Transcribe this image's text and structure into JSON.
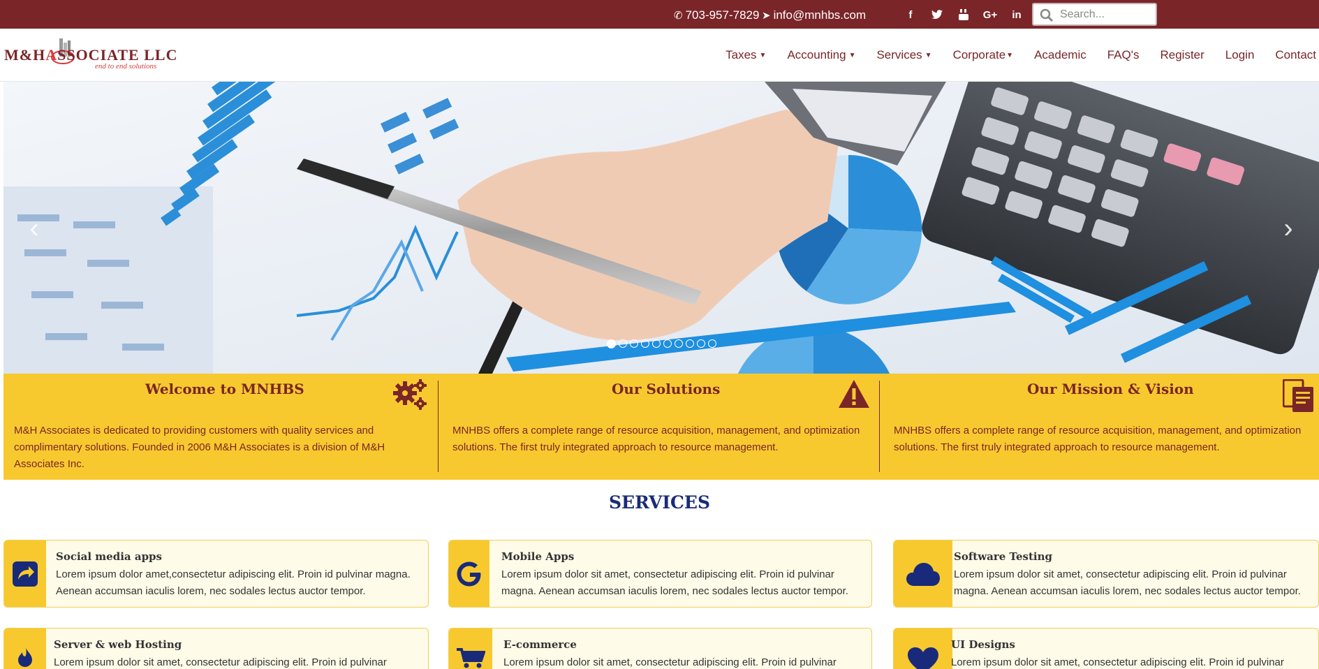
{
  "topbar": {
    "phone": "703-957-7829",
    "email": "info@mnhbs.com",
    "social": [
      "f",
      "t",
      "▶",
      "G+",
      "in"
    ],
    "search_placeholder": "Search..."
  },
  "logo": {
    "main_left": "M&H",
    "main_mid": "A",
    "main_right": "SSOCIATE LLC",
    "tagline": "end to end solutions"
  },
  "nav": {
    "items": [
      {
        "label": "Taxes",
        "dropdown": true
      },
      {
        "label": "Accounting",
        "dropdown": true
      },
      {
        "label": "Services",
        "dropdown": true
      },
      {
        "label": "Corporate",
        "dropdown": true
      },
      {
        "label": "Academic",
        "dropdown": false
      },
      {
        "label": "FAQ's",
        "dropdown": false
      },
      {
        "label": "Register",
        "dropdown": false
      },
      {
        "label": "Login",
        "dropdown": false
      },
      {
        "label": "Contact",
        "dropdown": false
      }
    ]
  },
  "hero": {
    "slide_count": 10,
    "active_slide": 1,
    "prev_label": "‹",
    "next_label": "›"
  },
  "band": {
    "welcome_title": "Welcome to MNHBS",
    "welcome_text": "M&H Associates is dedicated to providing customers with quality services and complimentary solutions. Founded in 2006 M&H Associates is a division of M&H Associates Inc.",
    "solutions_title": "Our Solutions",
    "solutions_text": "MNHBS offers a complete range of resource acquisition, management, and optimization solutions. The first truly integrated approach to resource management.",
    "mission_title": "Our Mission & Vision",
    "mission_text": "MNHBS offers a complete range of resource acquisition, management, and optimization solutions. The first truly integrated approach to resource management."
  },
  "services": {
    "title": "SERVICES",
    "items": [
      {
        "title": "Social media apps",
        "text": "Lorem ipsum dolor amet,consectetur adipiscing elit. Proin id pulvinar magna. Aenean accumsan iaculis lorem, nec sodales lectus auctor tempor.",
        "icon": "share-icon"
      },
      {
        "title": "Mobile Apps",
        "text": "Lorem ipsum dolor sit amet, consectetur adipiscing elit. Proin id pulvinar magna. Aenean accumsan iaculis lorem, nec sodales lectus auctor tempor.",
        "icon": "google-icon"
      },
      {
        "title": "Software Testing",
        "text": "Lorem ipsum dolor sit amet, consectetur adipiscing elit. Proin id pulvinar magna. Aenean accumsan iaculis lorem, nec sodales lectus auctor tempor.",
        "icon": "cloud-icon"
      },
      {
        "title": "Server & web Hosting",
        "text": "Lorem ipsum dolor sit amet, consectetur adipiscing elit. Proin id pulvinar magna.",
        "icon": "flame-icon"
      },
      {
        "title": "E-commerce",
        "text": "Lorem ipsum dolor sit amet, consectetur adipiscing elit. Proin id pulvinar",
        "icon": "cart-icon"
      },
      {
        "title": "UI Designs",
        "text": "Lorem ipsum dolor sit amet, consectetur adipiscing elit. Proin id pulvinar",
        "icon": "heart-icon"
      }
    ]
  },
  "colors": {
    "maroon": "#7a2528",
    "yellow": "#f8c92f",
    "navy": "#1a2a7a",
    "card_bg": "#fefbe8"
  }
}
